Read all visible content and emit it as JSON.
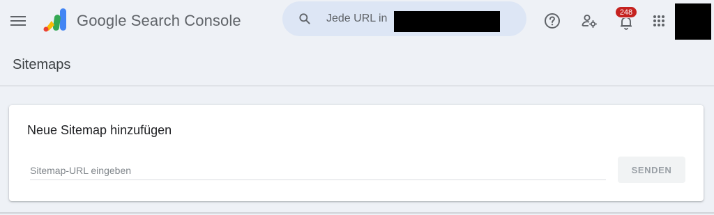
{
  "app": {
    "title": "Google Search Console",
    "logo_icon": "search-console-logo",
    "menu_icon": "hamburger-menu-icon"
  },
  "search": {
    "placeholder": "Jede URL in",
    "icon": "search-icon"
  },
  "toolbar": {
    "help_icon": "help-icon",
    "settings_icon": "person-settings-icon",
    "notifications_icon": "bell-icon",
    "notifications_count": "248",
    "apps_icon": "apps-grid-icon"
  },
  "page": {
    "title": "Sitemaps"
  },
  "card": {
    "title": "Neue Sitemap hinzufügen",
    "input_placeholder": "Sitemap-URL eingeben",
    "send_label": "SENDEN"
  },
  "colors": {
    "background": "#eef1f6",
    "search_bg": "#dde6f5",
    "badge": "#c5221f",
    "logo_blue": "#4285f4",
    "logo_green": "#34a853",
    "logo_yellow": "#fbbc04",
    "logo_red": "#ea4335"
  }
}
